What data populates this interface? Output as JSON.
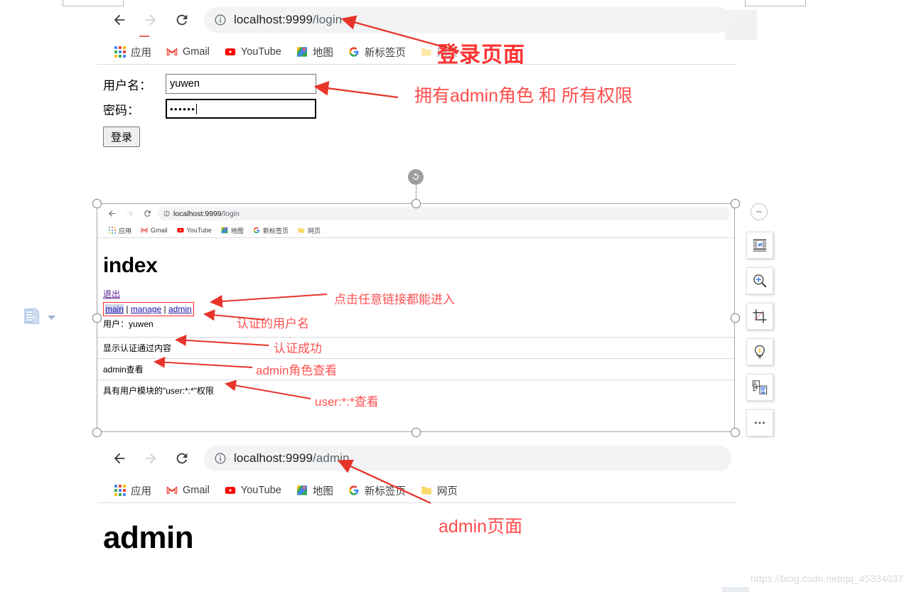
{
  "browser_top": {
    "name": "chrome-login-page",
    "nav": {
      "back": "back-arrow",
      "forward": "forward-arrow",
      "reload": "reload-icon"
    },
    "omnibox": {
      "info_icon": "info-circle-icon",
      "url_host": "localhost:9999",
      "url_path": "/login"
    },
    "bookmarks": [
      {
        "icon": "apps-grid-icon",
        "label": "应用"
      },
      {
        "icon": "gmail-icon",
        "label": "Gmail"
      },
      {
        "icon": "youtube-icon",
        "label": "YouTube"
      },
      {
        "icon": "maps-icon",
        "label": "地图"
      },
      {
        "icon": "google-icon",
        "label": "新标签页"
      },
      {
        "icon": "folder-icon",
        "label": "网页"
      }
    ]
  },
  "login_form": {
    "username_label": "用户名：",
    "username_value": "yuwen",
    "password_label": "密码：",
    "password_value": "••••••",
    "submit_label": "登录"
  },
  "annotations": {
    "login_page": "登录页面",
    "admin_role_and_perms": "拥有admin角色 和 所有权限",
    "click_any_link": "点击任意链接都能进入",
    "authenticated_username": "认证的用户名",
    "auth_success": "认证成功",
    "admin_role_view": "admin角色查看",
    "user_perm_view": "user:*:*查看",
    "admin_page": "admin页面"
  },
  "embedded_shot": {
    "name": "index-page-screenshot",
    "nav": {
      "back": "back-arrow",
      "forward": "forward-arrow",
      "reload": "reload-icon"
    },
    "omnibox": {
      "info_icon": "info-circle-icon",
      "url_host": "localhost:9999",
      "url_path": "/login"
    },
    "bookmarks": [
      {
        "icon": "apps-grid-icon",
        "label": "应用"
      },
      {
        "icon": "gmail-icon",
        "label": "Gmail"
      },
      {
        "icon": "youtube-icon",
        "label": "YouTube"
      },
      {
        "icon": "maps-icon",
        "label": "地图"
      },
      {
        "icon": "google-icon",
        "label": "新标签页"
      },
      {
        "icon": "folder-icon",
        "label": "网页"
      }
    ],
    "heading": "index",
    "logout_link": "退出",
    "nav_links": [
      "main",
      "manage",
      "admin"
    ],
    "nav_separator": " | ",
    "user_line": "用户：yuwen",
    "content_rows": [
      "显示认证通过内容",
      "admin查看",
      "具有用户模块的\"user:*:*\"权限"
    ]
  },
  "browser_bottom": {
    "name": "chrome-admin-page",
    "nav": {
      "back": "back-arrow",
      "forward": "forward-arrow",
      "reload": "reload-icon"
    },
    "omnibox": {
      "info_icon": "info-circle-icon",
      "url_host": "localhost:9999",
      "url_path": "/admin"
    },
    "bookmarks": [
      {
        "icon": "apps-grid-icon",
        "label": "应用"
      },
      {
        "icon": "gmail-icon",
        "label": "Gmail"
      },
      {
        "icon": "youtube-icon",
        "label": "YouTube"
      },
      {
        "icon": "maps-icon",
        "label": "地图"
      },
      {
        "icon": "google-icon",
        "label": "新标签页"
      },
      {
        "icon": "folder-icon",
        "label": "网页"
      }
    ],
    "heading": "admin"
  },
  "float_toolbar": {
    "collapse": "minus-circle-icon",
    "items": [
      {
        "icon": "layout-options-icon"
      },
      {
        "icon": "zoom-in-icon"
      },
      {
        "icon": "crop-icon"
      },
      {
        "icon": "design-ideas-icon"
      },
      {
        "icon": "picture-format-icon"
      },
      {
        "icon": "more-options-icon"
      }
    ]
  },
  "paste_options": {
    "icon": "paste-clipboard-icon",
    "dropdown": "chevron-down-icon"
  },
  "watermark": {
    "text": "https://blog.csdn.net/qq_45334037"
  },
  "colors": {
    "annotation_red": "#ff4d4d",
    "arrow_red": "#e8342a",
    "link_blue": "#1a0dab",
    "visited_purple": "#551a8b",
    "omnibox_bg": "#f1f3f4",
    "selection_gray": "#a6a6a6"
  }
}
